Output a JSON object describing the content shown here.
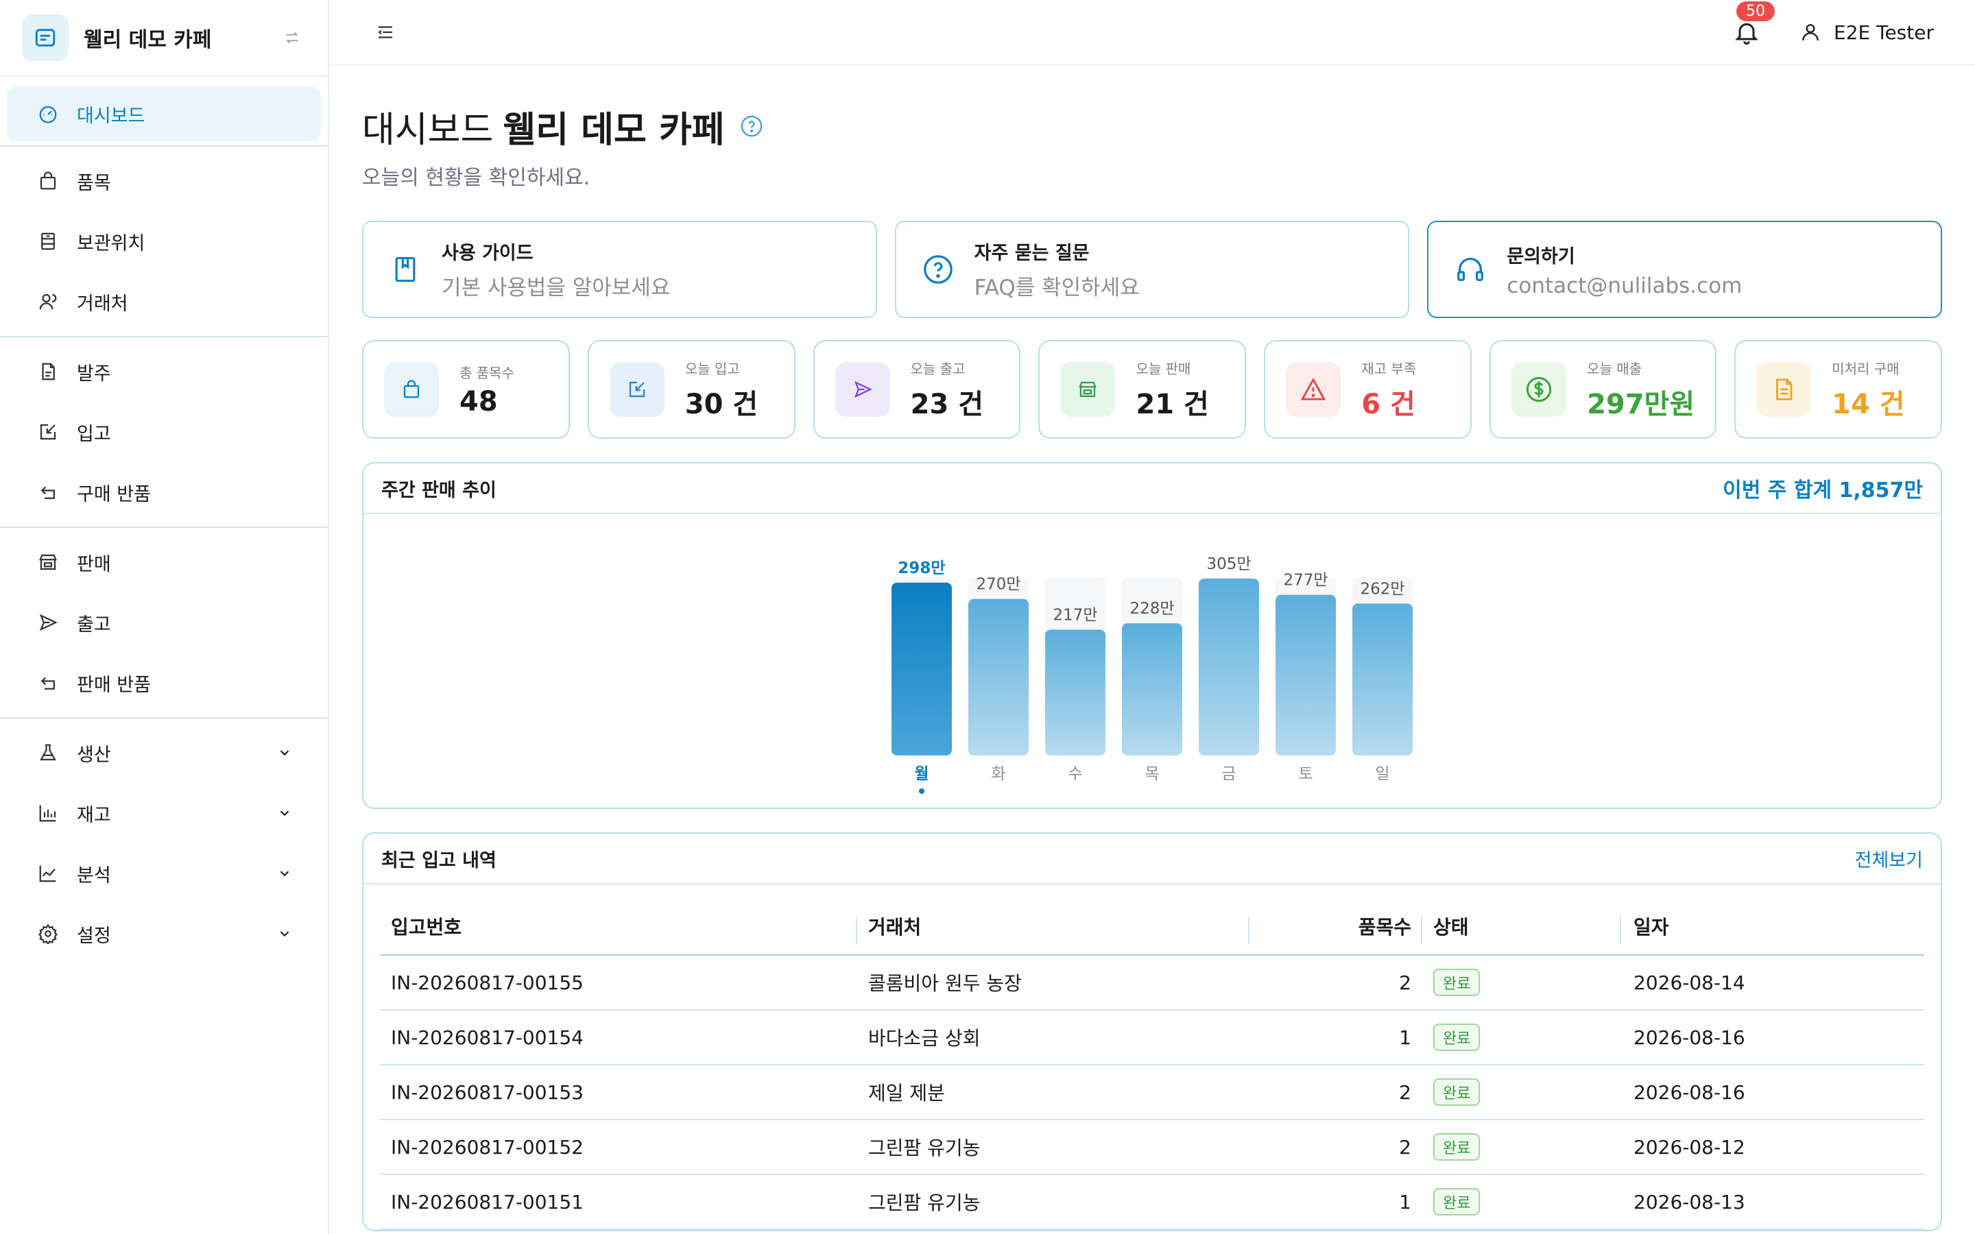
{
  "sidebar": {
    "brand": "웰리 데모 카페",
    "groups": [
      [
        {
          "label": "대시보드",
          "icon": "gauge-icon",
          "active": true
        }
      ],
      [
        {
          "label": "품목",
          "icon": "bag-icon"
        },
        {
          "label": "보관위치",
          "icon": "cabinet-icon"
        },
        {
          "label": "거래처",
          "icon": "users-icon"
        }
      ],
      [
        {
          "label": "발주",
          "icon": "document-icon"
        },
        {
          "label": "입고",
          "icon": "inbox-arrow-icon"
        },
        {
          "label": "구매 반품",
          "icon": "return-icon"
        }
      ],
      [
        {
          "label": "판매",
          "icon": "store-icon"
        },
        {
          "label": "출고",
          "icon": "send-icon"
        },
        {
          "label": "판매 반품",
          "icon": "return-icon"
        }
      ],
      [
        {
          "label": "생산",
          "icon": "flask-icon",
          "expandable": true
        },
        {
          "label": "재고",
          "icon": "bar-chart-icon",
          "expandable": true
        },
        {
          "label": "분석",
          "icon": "line-chart-icon",
          "expandable": true
        },
        {
          "label": "설정",
          "icon": "gear-icon",
          "expandable": true
        }
      ]
    ]
  },
  "topbar": {
    "notification_count": "50",
    "user_name": "E2E Tester"
  },
  "page": {
    "title_prefix": "대시보드",
    "title_main": "웰리 데모 카페",
    "subtitle": "오늘의 현황을 확인하세요."
  },
  "quick_links": [
    {
      "title": "사용 가이드",
      "sub": "기본 사용법을 알아보세요",
      "icon": "book-icon"
    },
    {
      "title": "자주 묻는 질문",
      "sub": "FAQ를 확인하세요",
      "icon": "question-circle-icon"
    },
    {
      "title": "문의하기",
      "sub": "contact@nulilabs.com",
      "icon": "headset-icon"
    }
  ],
  "stats": [
    {
      "label": "총 품목수",
      "value": "48",
      "icon": "bag-icon",
      "color": "#1a1a1a",
      "bg": "#e8f3fa",
      "ic": "#0a7fc2"
    },
    {
      "label": "오늘 입고",
      "value": "30 건",
      "icon": "inbox-arrow-icon",
      "color": "#1a1a1a",
      "bg": "#e6f0fc",
      "ic": "#2a7de1"
    },
    {
      "label": "오늘 출고",
      "value": "23 건",
      "icon": "send-icon",
      "color": "#1a1a1a",
      "bg": "#efeafb",
      "ic": "#7b3fe4"
    },
    {
      "label": "오늘 판매",
      "value": "21 건",
      "icon": "store-icon",
      "color": "#1a1a1a",
      "bg": "#e7f6ea",
      "ic": "#2e9d48"
    },
    {
      "label": "재고 부족",
      "value": "6 건",
      "icon": "warning-icon",
      "color": "#e84545",
      "bg": "#fdecec",
      "ic": "#e84545"
    },
    {
      "label": "오늘 매출",
      "value": "297만원",
      "icon": "dollar-icon",
      "color": "#3aa33a",
      "bg": "#eaf6e8",
      "ic": "#3aa33a"
    },
    {
      "label": "미처리 구매",
      "value": "14 건",
      "icon": "file-icon",
      "color": "#f0a21a",
      "bg": "#fdf3e1",
      "ic": "#f0a21a"
    }
  ],
  "weekly": {
    "title": "주간 판매 추이",
    "total_label": "이번 주 합계 1,857만"
  },
  "chart_data": {
    "type": "bar",
    "categories": [
      "월",
      "화",
      "수",
      "목",
      "금",
      "토",
      "일"
    ],
    "values": [
      298,
      270,
      217,
      228,
      305,
      277,
      262
    ],
    "value_labels": [
      "298만",
      "270만",
      "217만",
      "228만",
      "305만",
      "277만",
      "262만"
    ],
    "highlight_index": 0,
    "ylim": [
      0,
      305
    ],
    "color_highlight": "#0a7fc2",
    "color_bar": "#5aaedc"
  },
  "recent": {
    "title": "최근 입고 내역",
    "link": "전체보기",
    "columns": [
      "입고번호",
      "거래처",
      "품목수",
      "상태",
      "일자"
    ],
    "rows": [
      [
        "IN-20260817-00155",
        "콜롬비아 원두 농장",
        "2",
        "완료",
        "2026-08-14"
      ],
      [
        "IN-20260817-00154",
        "바다소금 상회",
        "1",
        "완료",
        "2026-08-16"
      ],
      [
        "IN-20260817-00153",
        "제일 제분",
        "2",
        "완료",
        "2026-08-16"
      ],
      [
        "IN-20260817-00152",
        "그린팜 유기농",
        "2",
        "완료",
        "2026-08-12"
      ],
      [
        "IN-20260817-00151",
        "그린팜 유기농",
        "1",
        "완료",
        "2026-08-13"
      ]
    ]
  }
}
